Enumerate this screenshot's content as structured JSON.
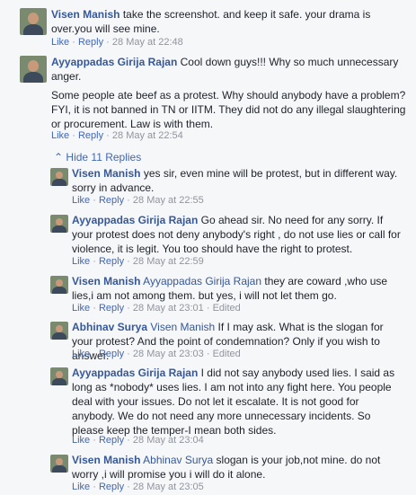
{
  "comments": [
    {
      "author": "Visen Manish",
      "text": "take the screenshot. and keep it safe. your drama is over.you will see mine.",
      "like": "Like",
      "reply": "Reply",
      "timestamp": "28 May at 22:48"
    },
    {
      "author": "Ayyappadas Girija Rajan",
      "text": "Cool down guys!!! Why so much unnecessary anger.",
      "text2": "Some people ate beef as a protest. Why should anybody have a problem? FYI, it is not banned in TN or IITM. They did not do any illegal slaughtering or procurement. Law is with them.",
      "like": "Like",
      "reply": "Reply",
      "timestamp": "28 May at 22:54"
    }
  ],
  "hide_replies": "Hide 11 Replies",
  "replies": [
    {
      "author": "Visen Manish",
      "text": "yes sir, even mine will be protest, but in different way. sorry in advance.",
      "like": "Like",
      "reply": "Reply",
      "timestamp": "28 May at 22:55"
    },
    {
      "author": "Ayyappadas Girija Rajan",
      "text": "Go ahead sir. No need for any sorry. If your protest does not deny anybody's right , do not use lies or call for violence, it is legit. You too should have the right to protest.",
      "like": "Like",
      "reply": "Reply",
      "timestamp": "28 May at 22:59"
    },
    {
      "author": "Visen Manish",
      "mention": "Ayyappadas Girija Rajan",
      "text": "they are coward ,who use lies,i am not among them. but yes, i will not let them go.",
      "like": "Like",
      "reply": "Reply",
      "timestamp": "28 May at 23:01",
      "edited": "Edited"
    },
    {
      "author": "Abhinav Surya",
      "mention": "Visen Manish",
      "text": "If I may ask. What is the slogan for your protest? And the point of condemnation? Only if you wish to answer.",
      "like": "Like",
      "reply": "Reply",
      "timestamp": "28 May at 23:03",
      "edited": "Edited"
    },
    {
      "author": "Ayyappadas Girija Rajan",
      "text": "I did not say anybody used lies. I said as long as *nobody* uses lies. I am not into any fight here. You people deal with your issues. Do not let it escalate. It is not good for anybody. We do not need any more unnecessary incidents. So please keep the temper-I mean both sides.",
      "like": "Like",
      "reply": "Reply",
      "timestamp": "28 May at 23:04"
    },
    {
      "author": "Visen Manish",
      "mention": "Abhinav Surya",
      "text": "slogan is your job,not mine. do not worry ,i will promise you i will do it alone.",
      "like": "Like",
      "reply": "Reply",
      "timestamp": "28 May at 23:05"
    }
  ]
}
